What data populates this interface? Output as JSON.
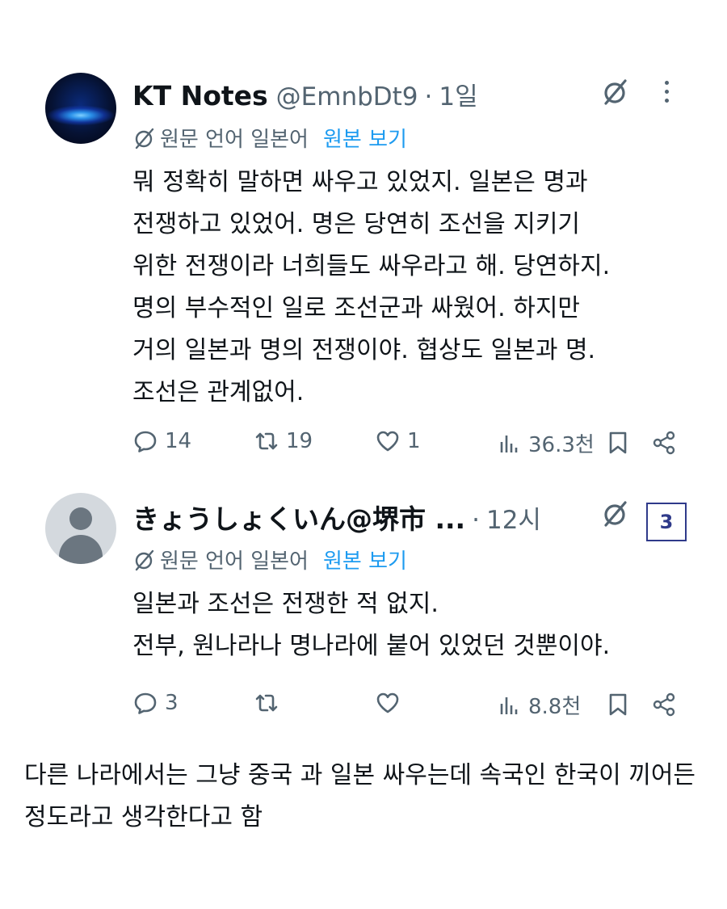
{
  "tweets": [
    {
      "display_name": "KT Notes",
      "handle": "@EmnbDt9",
      "separator": "·",
      "time": "1일",
      "translation_note": "원문 언어 일본어",
      "show_original": "원본 보기",
      "text": "뭐 정확히 말하면 싸우고 있었지. 일본은 명과\n전쟁하고 있었어. 명은 당연히 조선을 지키기\n위한 전쟁이라 너희들도 싸우라고 해. 당연하지.\n명의 부수적인 일로 조선군과 싸웠어. 하지만\n거의 일본과 명의 전쟁이야. 협상도 일본과 명.\n조선은 관계없어.",
      "replies": "14",
      "reposts": "19",
      "likes": "1",
      "views": "36.3천"
    },
    {
      "display_name": "きょうしょくいん@堺市 ...",
      "separator": "·",
      "time": "12시",
      "translation_note": "원문 언어 일본어",
      "show_original": "원본 보기",
      "text": "일본과 조선은 전쟁한 적 없지.\n전부, 원나라나 명나라에 붙어 있었던 것뿐이야.",
      "replies": "3",
      "reposts": "",
      "likes": "",
      "views": "8.8천"
    }
  ],
  "badge": "3",
  "caption": "다른 나라에서는 그냥 중국 과 일본 싸우는데 속국인 한국이 끼어든 정도라고 생각한다고 함",
  "icons": [
    "grok-icon",
    "more-icon",
    "translate-icon",
    "reply-icon",
    "repost-icon",
    "like-icon",
    "views-icon",
    "bookmark-icon",
    "share-icon"
  ],
  "colors": {
    "text": "#0f1419",
    "secondary": "#536471",
    "link": "#1d9bf0",
    "badge": "#2f3a8a"
  }
}
